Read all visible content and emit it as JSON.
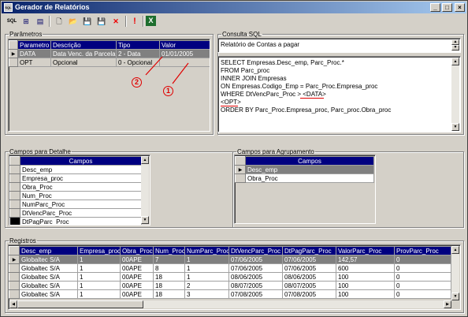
{
  "window": {
    "title": "Gerador de Relatórios",
    "icon_text": "SQL",
    "btn_min": "_",
    "btn_max": "□",
    "btn_close": "×"
  },
  "toolbar": {
    "items": [
      {
        "name": "sql-icon",
        "glyph": "SQL"
      },
      {
        "name": "tree-icon",
        "glyph": "⊞"
      },
      {
        "name": "grid-icon",
        "glyph": "▤"
      },
      {
        "name": "new-icon",
        "glyph": "🗋"
      },
      {
        "name": "open-icon",
        "glyph": "📂"
      },
      {
        "name": "save-icon",
        "glyph": "💾"
      },
      {
        "name": "save-as-icon",
        "glyph": "💾"
      },
      {
        "name": "delete-icon",
        "glyph": "✕"
      },
      {
        "name": "exclamation-icon",
        "glyph": "!"
      },
      {
        "name": "excel-icon",
        "glyph": "X"
      }
    ]
  },
  "parametros": {
    "legend": "Parâmetros",
    "headers": [
      "Parametro",
      "Descrição",
      "Tipo",
      "Valor"
    ],
    "rows": [
      {
        "indicator": "▶",
        "cells": [
          "DATA",
          "Data Venc. da Parcela",
          "2 - Data",
          "01/01/2005"
        ]
      },
      {
        "indicator": "",
        "cells": [
          "OPT",
          "Opcional",
          "0 - Opcional",
          ""
        ]
      }
    ]
  },
  "consulta": {
    "legend": "Consulta SQL",
    "description": "Relatório de Contas a pagar",
    "sql_lines": [
      "SELECT Empresas.Desc_emp, Parc_Proc.*",
      "FROM Parc_proc",
      "INNER JOIN Empresas",
      "ON Empresas.Codigo_Emp = Parc_Proc.Empresa_proc",
      "WHERE DtVencParc_Proc > <DATA>",
      "<OPT>",
      "ORDER BY Parc_Proc.Empresa_proc, Parc_proc.Obra_proc"
    ]
  },
  "markers": {
    "one": "1",
    "two": "2"
  },
  "campos_detalhe": {
    "legend": "Campos para Detalhe",
    "header": "Campos",
    "items": [
      "Desc_emp",
      "Empresa_proc",
      "Obra_Proc",
      "Num_Proc",
      "NumParc_Proc",
      "DtVencParc_Proc",
      "DtPagParc_Proc"
    ]
  },
  "campos_agrupamento": {
    "legend": "Campos para Agrupamento",
    "header": "Campos",
    "items": [
      "Desc_emp",
      "Obra_Proc"
    ]
  },
  "registros": {
    "legend": "Registros",
    "headers": [
      "Desc_emp",
      "Empresa_proc",
      "Obra_Proc",
      "Num_Proc",
      "NumParc_Proc",
      "DtVencParc_Proc",
      "DtPagParc_Proc",
      "ValorParc_Proc",
      "ProvParc_Proc"
    ],
    "rows": [
      [
        "Globaltec S/A",
        "1",
        "00APE",
        "7",
        "1",
        "07/06/2005",
        "07/06/2005",
        "142,57",
        "0"
      ],
      [
        "Globaltec S/A",
        "1",
        "00APE",
        "8",
        "1",
        "07/06/2005",
        "07/06/2005",
        "600",
        "0"
      ],
      [
        "Globaltec S/A",
        "1",
        "00APE",
        "18",
        "1",
        "08/06/2005",
        "08/06/2005",
        "100",
        "0"
      ],
      [
        "Globaltec S/A",
        "1",
        "00APE",
        "18",
        "2",
        "08/07/2005",
        "08/07/2005",
        "100",
        "0"
      ],
      [
        "Globaltec S/A",
        "1",
        "00APE",
        "18",
        "3",
        "07/08/2005",
        "07/08/2005",
        "100",
        "0"
      ]
    ]
  }
}
